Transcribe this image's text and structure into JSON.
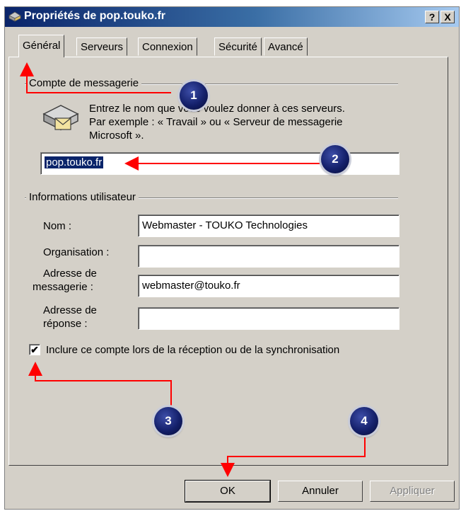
{
  "window": {
    "title": "Propriétés de pop.touko.fr",
    "help_label": "?",
    "close_label": "X"
  },
  "tabs": [
    {
      "label": "Général",
      "active": true
    },
    {
      "label": "Serveurs"
    },
    {
      "label": "Connexion"
    },
    {
      "label": "Sécurité"
    },
    {
      "label": "Avancé"
    }
  ],
  "mail_account": {
    "group_label": "Compte de messagerie",
    "description_1": "Entrez le nom que vous voulez donner à ces serveurs.",
    "description_2": "Par exemple : « Travail » ou « Serveur de messagerie",
    "description_3": "Microsoft ».",
    "account_name": "pop.touko.fr"
  },
  "user_info": {
    "group_label": "Informations utilisateur",
    "name_label": "Nom :",
    "name_value": "Webmaster - TOUKO Technologies",
    "organization_label": "Organisation :",
    "organization_value": "",
    "email_label_1": "Adresse de",
    "email_label_2": "messagerie :",
    "email_value": "webmaster@touko.fr",
    "reply_label_1": "Adresse de",
    "reply_label_2": "réponse :",
    "reply_value": ""
  },
  "include_checkbox": {
    "checked": true,
    "label": "Inclure ce compte lors de la réception ou de la synchronisation"
  },
  "buttons": {
    "ok": "OK",
    "cancel": "Annuler",
    "apply": "Appliquer"
  },
  "annotations": [
    "1",
    "2",
    "3",
    "4"
  ],
  "colors": {
    "accent": "#ff0000",
    "badge": "#14206b",
    "titlebar": "#0a246a",
    "selection": "#0a246a"
  }
}
